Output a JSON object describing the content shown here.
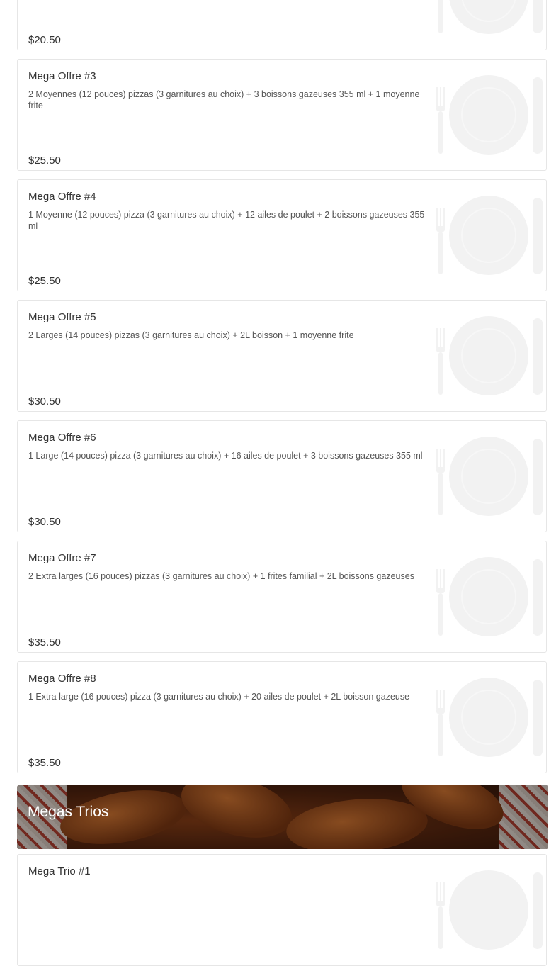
{
  "items": [
    {
      "name": "",
      "description": "",
      "price": "$20.50"
    },
    {
      "name": "Mega Offre #3",
      "description": "2 Moyennes (12 pouces) pizzas (3 garnitures au choix) + 3 boissons gazeuses 355 ml + 1 moyenne frite",
      "price": "$25.50"
    },
    {
      "name": "Mega Offre #4",
      "description": "1 Moyenne (12 pouces) pizza (3 garnitures au choix) + 12 ailes de poulet + 2 boissons gazeuses 355 ml",
      "price": "$25.50"
    },
    {
      "name": "Mega Offre #5",
      "description": "2 Larges (14 pouces) pizzas (3 garnitures au choix) + 2L boisson + 1 moyenne frite",
      "price": "$30.50"
    },
    {
      "name": "Mega Offre #6",
      "description": "1 Large (14 pouces) pizza (3 garnitures au choix) + 16 ailes de poulet + 3 boissons gazeuses 355 ml",
      "price": "$30.50"
    },
    {
      "name": "Mega Offre #7",
      "description": "2 Extra larges (16 pouces) pizzas (3 garnitures au choix) + 1 frites familial + 2L boissons gazeuses",
      "price": "$35.50"
    },
    {
      "name": "Mega Offre #8",
      "description": "1 Extra large (16 pouces) pizza (3 garnitures au choix) + 20 ailes de poulet + 2L boisson gazeuse",
      "price": "$35.50"
    }
  ],
  "section": {
    "title": "Megas Trios"
  },
  "next_item": {
    "name": "Mega Trio #1"
  },
  "icons": {
    "placeholder": "plate-utensils-icon"
  },
  "colors": {
    "placeholder": "#f2f2f2",
    "border": "#e6e6e6"
  }
}
